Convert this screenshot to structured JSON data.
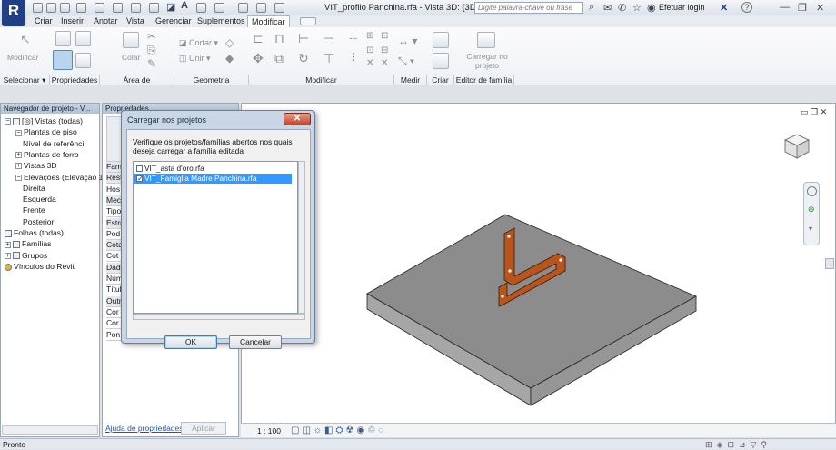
{
  "app": {
    "logo_letter": "R",
    "window_title": "VIT_profilo Panchina.rfa - Vista 3D: {3D}",
    "search_placeholder": "Digite palavra-chave ou frase",
    "login_label": "Efetuar login",
    "help_label": "?"
  },
  "menu_tabs": [
    "Criar",
    "Inserir",
    "Anotar",
    "Vista",
    "Gerenciar",
    "Suplementos",
    "Modificar"
  ],
  "ribbon": {
    "groups": [
      "Selecionar ▾",
      "Propriedades",
      "Área de transferência",
      "Geometria",
      "Modificar",
      "Medir",
      "Criar",
      "Editor de família"
    ],
    "modify_btn": "Modificar",
    "paste_btn": "Colar",
    "cut_btn": "Cortar",
    "join_btn": "Unir",
    "load_btn_line1": "Carregar no",
    "load_btn_line2": "projeto"
  },
  "browser": {
    "title": "Navegador de projeto - V...",
    "items": [
      {
        "label": "[◎] Vistas (todas)",
        "level": 0,
        "exp": "−"
      },
      {
        "label": "Plantas de piso",
        "level": 1,
        "exp": "−"
      },
      {
        "label": "Nível de referênci",
        "level": 2,
        "exp": ""
      },
      {
        "label": "Plantas de forro",
        "level": 1,
        "exp": "+"
      },
      {
        "label": "Vistas 3D",
        "level": 1,
        "exp": "+"
      },
      {
        "label": "Elevações (Elevação 1",
        "level": 1,
        "exp": "−"
      },
      {
        "label": "Direita",
        "level": 2,
        "exp": ""
      },
      {
        "label": "Esquerda",
        "level": 2,
        "exp": ""
      },
      {
        "label": "Frente",
        "level": 2,
        "exp": ""
      },
      {
        "label": "Posterior",
        "level": 2,
        "exp": ""
      },
      {
        "label": "Folhas (todas)",
        "level": 0,
        "exp": ""
      },
      {
        "label": "Famílias",
        "level": 0,
        "exp": "+"
      },
      {
        "label": "Grupos",
        "level": 0,
        "exp": "+"
      },
      {
        "label": "Vínculos do Revit",
        "level": 0,
        "exp": ""
      }
    ]
  },
  "properties": {
    "title": "Propriedades",
    "rows": [
      "Fami",
      "Restr",
      "Hos",
      "Meca",
      "Tipo",
      "Estru",
      "Pod",
      "Cota",
      "Cot",
      "Dado",
      "Núm",
      "Títul",
      "Outr",
      "Cor",
      "Cor",
      "Pon"
    ],
    "help_link": "Ajuda de propriedades",
    "apply_btn": "Aplicar"
  },
  "dialog": {
    "title": "Carregar nos projetos",
    "close_label": "✕",
    "description": "Verifique os projetos/famílias abertos nos quais deseja carregar a família editada",
    "list": [
      {
        "label": "VIT_asta d'oro.rfa",
        "checked": false,
        "selected": false
      },
      {
        "label": "VIT_Famiglia Madre Panchina.rfa",
        "checked": true,
        "selected": true
      }
    ],
    "ok_label": "OK",
    "cancel_label": "Cancelar"
  },
  "view_controls": {
    "scale": "1 : 100"
  },
  "status": {
    "text": "Pronto"
  },
  "colors": {
    "slab_top": "#8c8c8c",
    "slab_side": "#9a9a9a",
    "profile": "#b8541c",
    "selection_blue": "#3399ff"
  }
}
